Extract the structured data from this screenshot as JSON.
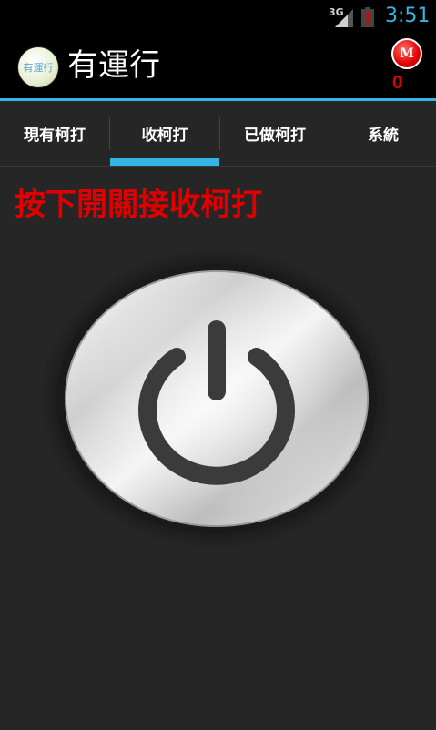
{
  "status_bar": {
    "network": "3G",
    "time": "3:51",
    "icons": [
      "signal-icon",
      "battery-alert-icon"
    ]
  },
  "action_bar": {
    "logo_text": "有運行",
    "title": "有運行",
    "badge_letter": "M",
    "badge_count": "0"
  },
  "tabs": [
    {
      "label": "現有柯打",
      "selected": false
    },
    {
      "label": "收柯打",
      "selected": true
    },
    {
      "label": "已做柯打",
      "selected": false
    },
    {
      "label": "系統",
      "selected": false
    }
  ],
  "main": {
    "instruction": "按下開關接收柯打",
    "power_button_icon": "power-icon"
  },
  "colors": {
    "accent": "#33b5e5",
    "alert": "#e00000",
    "background": "#262626"
  }
}
